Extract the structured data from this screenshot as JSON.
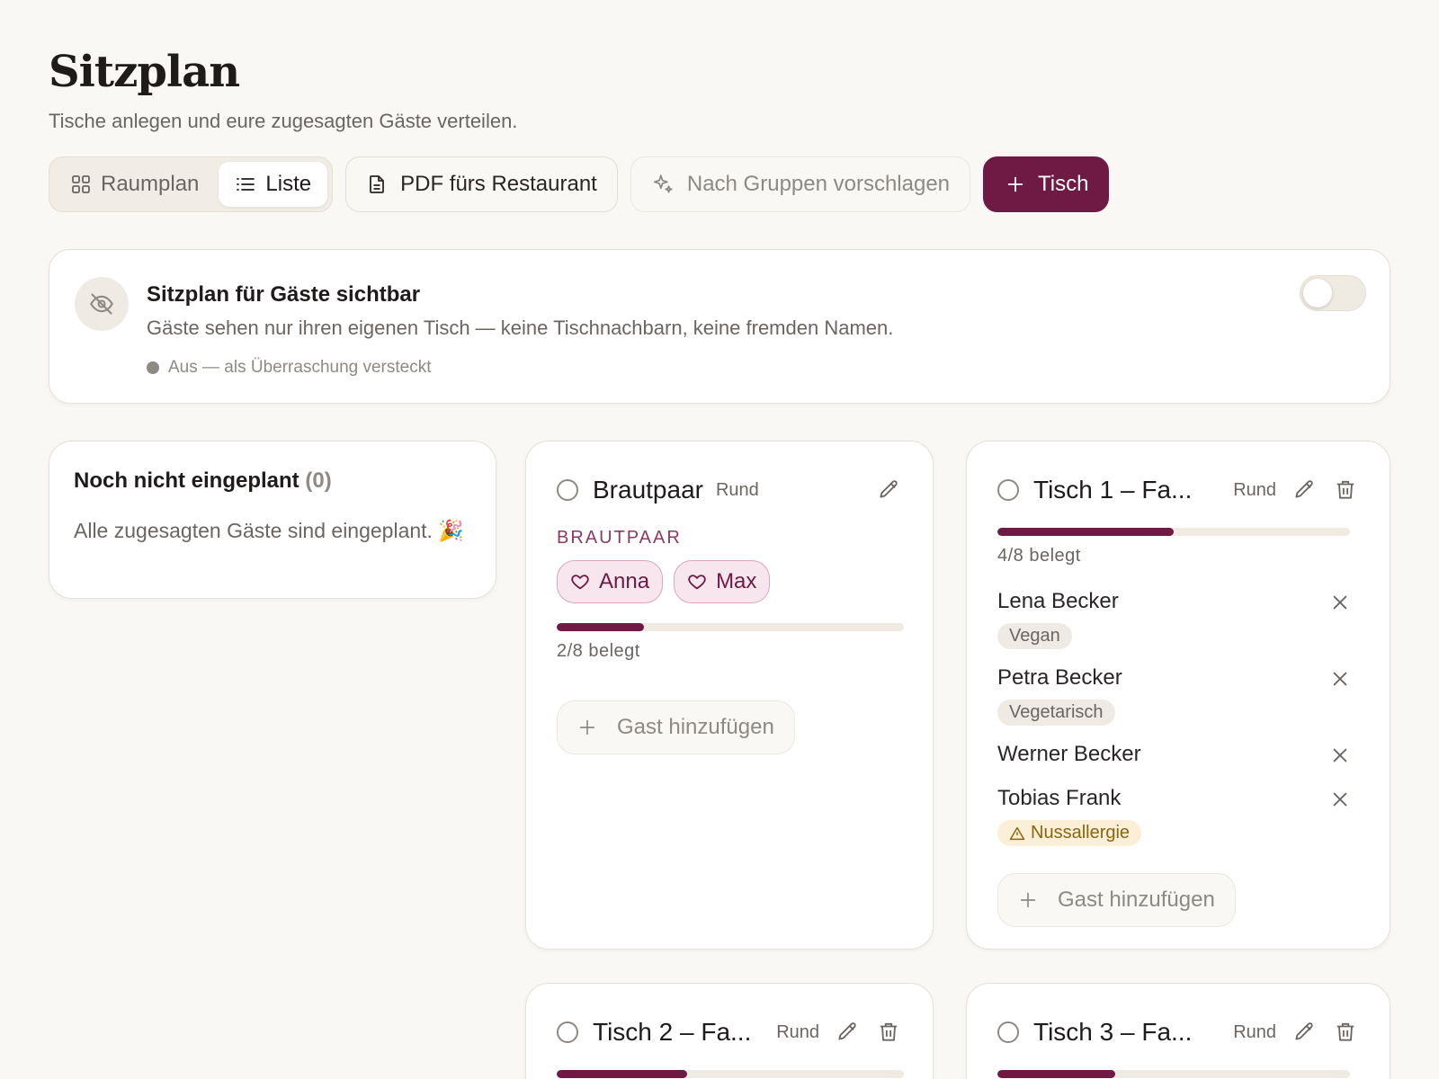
{
  "header": {
    "title": "Sitzplan",
    "subtitle": "Tische anlegen und eure zugesagten Gäste verteilen."
  },
  "toolbar": {
    "view_toggle": {
      "room_label": "Raumplan",
      "list_label": "Liste",
      "active": "Liste"
    },
    "pdf_label": "PDF fürs Restaurant",
    "suggest_label": "Nach Gruppen vorschlagen",
    "add_table_label": "Tisch"
  },
  "visibility": {
    "title": "Sitzplan für Gäste sichtbar",
    "description": "Gäste sehen nur ihren eigenen Tisch — keine Tischnachbarn, keine fremden Namen.",
    "status": "Aus — als Überraschung versteckt",
    "enabled": false
  },
  "unplanned": {
    "title": "Noch nicht eingeplant",
    "count": "(0)",
    "message": "Alle zugesagten Gäste sind eingeplant. 🎉"
  },
  "tables": [
    {
      "name": "Brautpaar",
      "shape": "Rund",
      "section_label": "BRAUTPAAR",
      "couple": [
        "Anna",
        "Max"
      ],
      "occupancy": "2/8 belegt",
      "fill": 0.25,
      "add_guest_label": "Gast hinzufügen"
    },
    {
      "name": "Tisch 1 – Fa...",
      "shape": "Rund",
      "occupancy": "4/8 belegt",
      "fill": 0.5,
      "guests": [
        {
          "name": "Lena Becker",
          "tag": "Vegan"
        },
        {
          "name": "Petra Becker",
          "tag": "Vegetarisch"
        },
        {
          "name": "Werner Becker"
        },
        {
          "name": "Tobias Frank",
          "tag": "Nussallergie",
          "warn": true
        }
      ],
      "add_guest_label": "Gast hinzufügen"
    },
    {
      "name": "Tisch 2 – Fa...",
      "shape": "Rund",
      "fill": 0.375
    },
    {
      "name": "Tisch 3 – Fa...",
      "shape": "Rund",
      "fill": 0.333
    }
  ],
  "colors": {
    "accent": "#6e1a45",
    "background": "#faf8f4",
    "warning": "#8b6510"
  }
}
